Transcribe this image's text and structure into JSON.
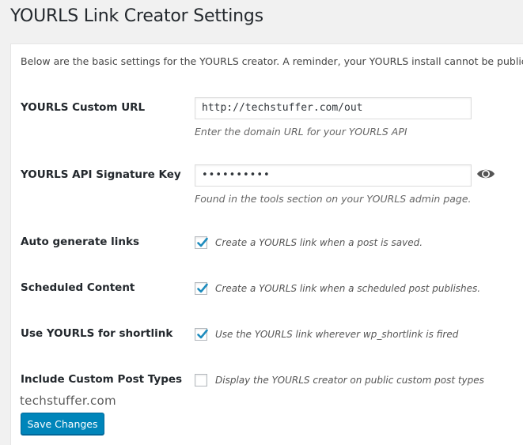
{
  "page": {
    "title": "YOURLS Link Creator Settings"
  },
  "intro": "Below are the basic settings for the YOURLS creator. A reminder, your YOURLS install cannot be public.",
  "fields": {
    "custom_url": {
      "label": "YOURLS Custom URL",
      "value": "http://techstuffer.com/out",
      "description": "Enter the domain URL for your YOURLS API"
    },
    "api_key": {
      "label": "YOURLS API Signature Key",
      "value": "••••••••••",
      "description": "Found in the tools section on your YOURLS admin page.",
      "icon": "eye-icon"
    }
  },
  "options": [
    {
      "label": "Auto generate links",
      "text": "Create a YOURLS link when a post is saved.",
      "checked": true
    },
    {
      "label": "Scheduled Content",
      "text": "Create a YOURLS link when a scheduled post publishes.",
      "checked": true
    },
    {
      "label": "Use YOURLS for shortlink",
      "text": "Use the YOURLS link wherever wp_shortlink is fired",
      "checked": true
    },
    {
      "label": "Include Custom Post Types",
      "text": "Display the YOURLS creator on public custom post types",
      "checked": false
    }
  ],
  "watermark": "techstuffer.com",
  "save_label": "Save Changes",
  "colors": {
    "primary_button": "#0085ba",
    "check": "#1e8cbe"
  }
}
